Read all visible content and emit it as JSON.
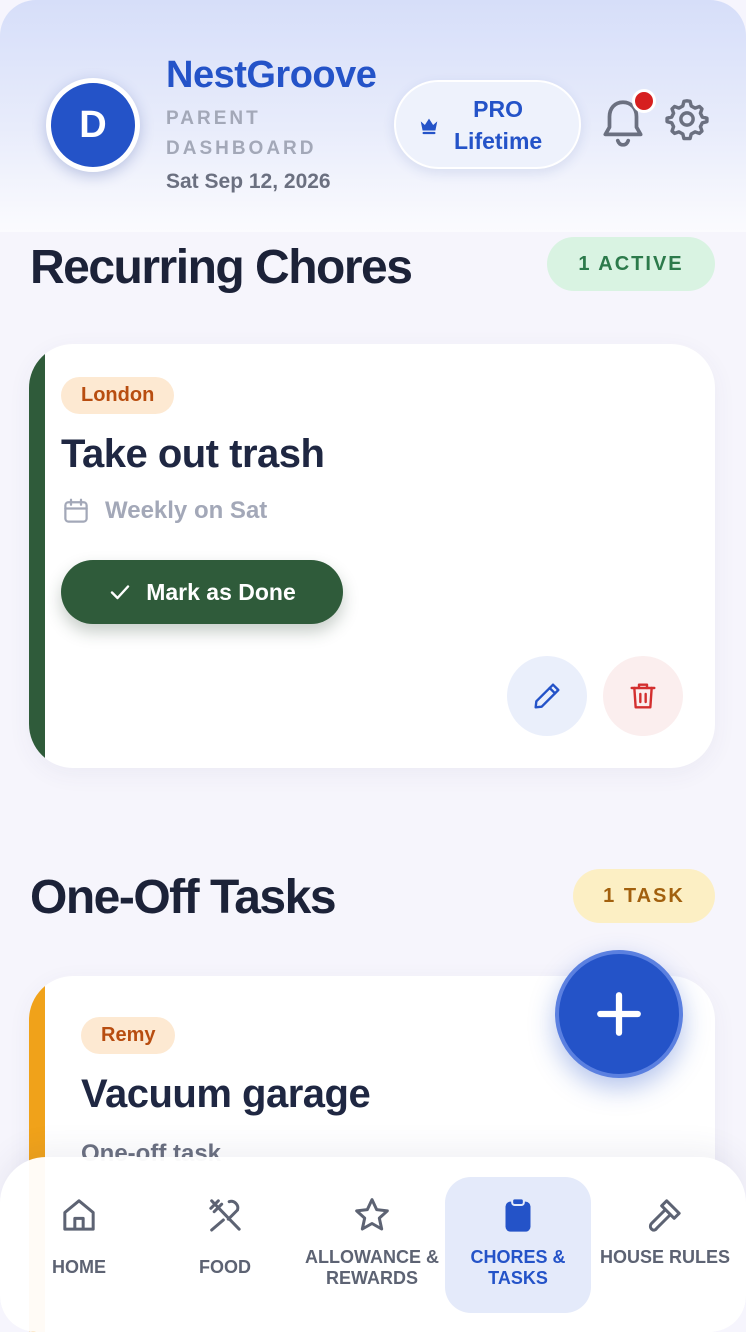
{
  "header": {
    "avatar_initial": "D",
    "brand": "NestGroove",
    "role_line1": "PARENT",
    "role_line2": "DASHBOARD",
    "date": "Sat Sep 12, 2026",
    "pro_line1": "PRO",
    "pro_line2": "Lifetime",
    "has_notification": true
  },
  "recurring": {
    "title": "Recurring Chores",
    "badge": "1 ACTIVE",
    "chore": {
      "assignee": "London",
      "name": "Take out trash",
      "schedule": "Weekly on Sat",
      "done_label": "Mark as Done"
    }
  },
  "oneoff": {
    "title": "One-Off Tasks",
    "badge": "1 TASK",
    "task": {
      "assignee": "Remy",
      "name": "Vacuum garage",
      "subtitle": "One-off task"
    }
  },
  "nav": {
    "items": [
      {
        "label": "HOME",
        "icon": "home-icon"
      },
      {
        "label": "FOOD",
        "icon": "utensils-icon"
      },
      {
        "label": "ALLOWANCE & REWARDS",
        "icon": "star-icon"
      },
      {
        "label": "CHORES & TASKS",
        "icon": "clipboard-icon",
        "active": true
      },
      {
        "label": "HOUSE RULES",
        "icon": "gavel-icon"
      }
    ]
  },
  "colors": {
    "accent": "#2453c8",
    "recurring_strip": "#2f5b3a",
    "oneoff_strip": "#f0a21a",
    "notification": "#d61f1f"
  }
}
